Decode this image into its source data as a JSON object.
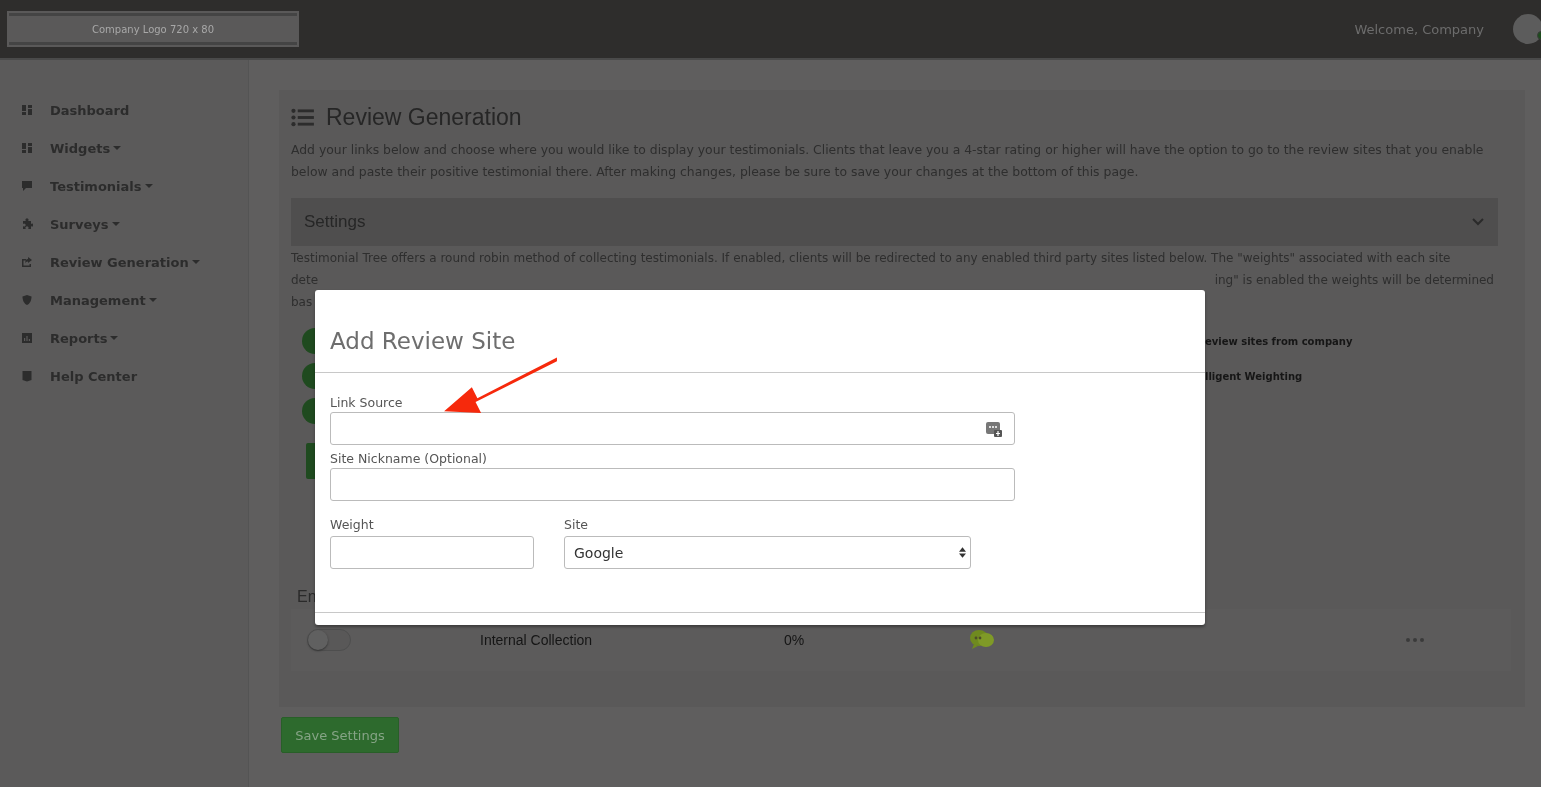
{
  "header": {
    "logo_text": "Company Logo 720 x 80",
    "welcome": "Welcome, Company",
    "avatar": {
      "online": true
    }
  },
  "sidebar": {
    "items": [
      {
        "label": "Dashboard",
        "dropdown": false
      },
      {
        "label": "Widgets",
        "dropdown": true
      },
      {
        "label": "Testimonials",
        "dropdown": true
      },
      {
        "label": "Surveys",
        "dropdown": true
      },
      {
        "label": "Review Generation",
        "dropdown": true
      },
      {
        "label": "Management",
        "dropdown": true
      },
      {
        "label": "Reports",
        "dropdown": true
      },
      {
        "label": "Help Center",
        "dropdown": false
      }
    ]
  },
  "page": {
    "title": "Review Generation",
    "intro": "Add your links below and choose where you would like to display your testimonials. Clients that leave you a 4-star rating or higher will have the option to go to the review sites that you enable below and paste their positive testimonial there. After making changes, please be sure to save your changes at the bottom of this page.",
    "settings": {
      "title": "Settings",
      "expanded": true,
      "description_fragments": [
        "Testimonial Tree offers a round robin method of collecting testimonials. If enabled, clients will be redirected to any enabled third party sites listed below. The \"weights\" associated with each site",
        "dete",
        "ing\" is enabled the weights will be determined",
        "bas"
      ],
      "options": [
        {
          "on": true,
          "text_fragment": "eview sites from company"
        },
        {
          "on": true,
          "text_fragment": "lligent Weighting"
        },
        {
          "on": true
        }
      ]
    },
    "table": {
      "header_fragment": "En",
      "rows": [
        {
          "enabled": false,
          "name": "Internal Collection",
          "weight": "0%"
        }
      ]
    },
    "save_button": "Save Settings"
  },
  "modal": {
    "title": "Add Review Site",
    "link_source": {
      "label": "Link Source"
    },
    "nickname": {
      "label": "Site Nickname (Optional)"
    },
    "weight": {
      "label": "Weight"
    },
    "site": {
      "label": "Site",
      "value": "Google"
    }
  }
}
